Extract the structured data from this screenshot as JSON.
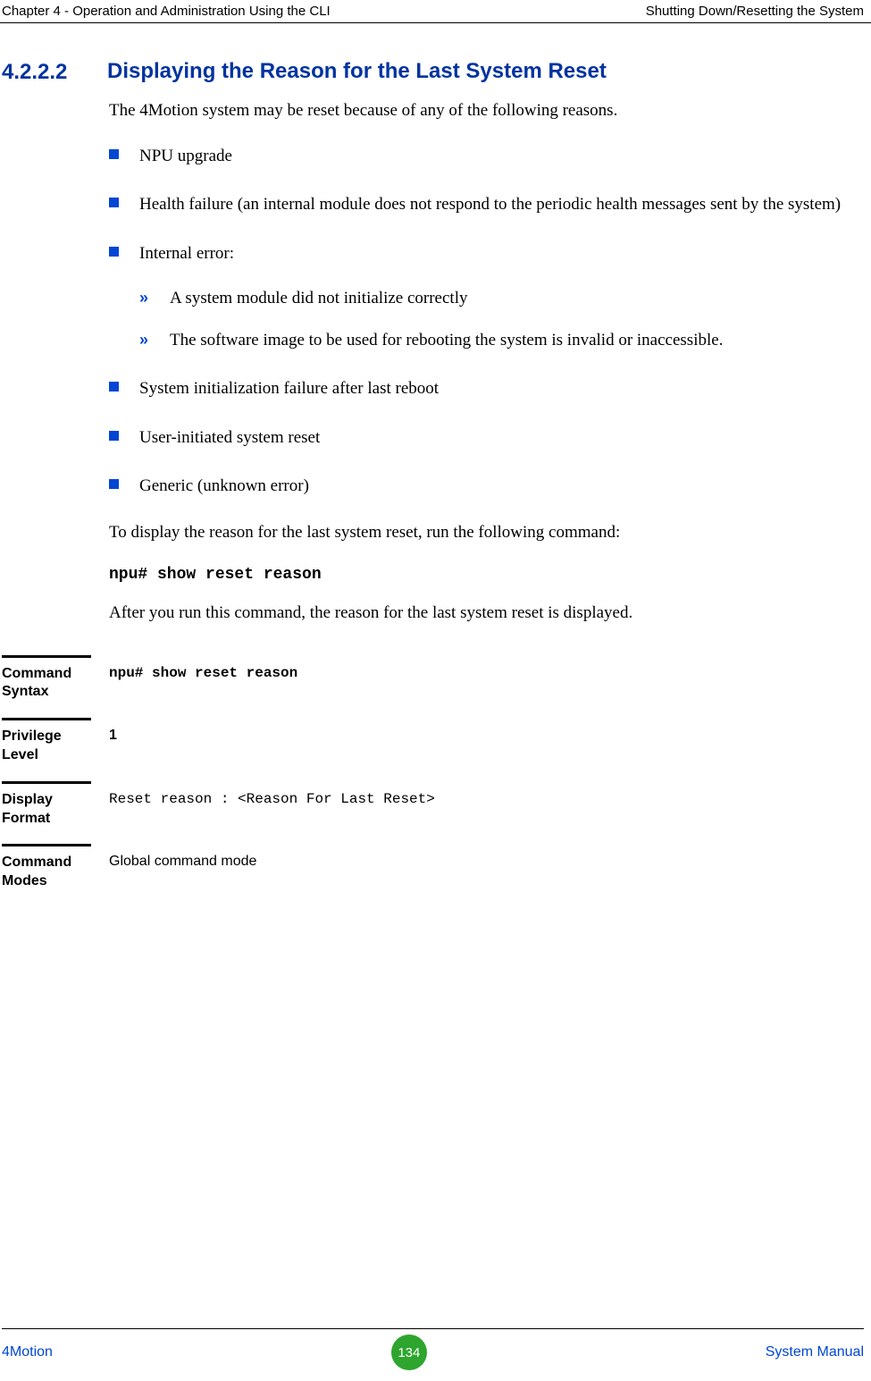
{
  "header": {
    "left": "Chapter 4 - Operation and Administration Using the CLI",
    "right": "Shutting Down/Resetting the System"
  },
  "section": {
    "number": "4.2.2.2",
    "title": "Displaying the Reason for the Last System Reset"
  },
  "intro": "The 4Motion system may be reset because of any of the following reasons.",
  "bullets": {
    "b1": "NPU upgrade",
    "b2": "Health failure (an internal module does not respond to the periodic health messages sent by the system)",
    "b3": "Internal error:",
    "b3_sub1": "A system module did not initialize correctly",
    "b3_sub2": "The software image to be used for rebooting the system is invalid or inaccessible.",
    "b4": "System initialization failure after last reboot",
    "b5": "User-initiated system reset",
    "b6": "Generic (unknown error)"
  },
  "para2": "To display the reason for the last system reset, run the following command:",
  "command": "npu# show reset reason",
  "para3": "After you run this command, the reason for the last system reset is displayed.",
  "ref": {
    "syntax_label": "Command Syntax",
    "syntax_value": "npu# show reset reason",
    "privilege_label": "Privilege Level",
    "privilege_value": "1",
    "display_label": "Display Format",
    "display_value": "Reset reason : <Reason For Last Reset>",
    "modes_label": "Command Modes",
    "modes_value": "Global command mode"
  },
  "footer": {
    "left": "4Motion",
    "page": "134",
    "right": "System Manual"
  }
}
